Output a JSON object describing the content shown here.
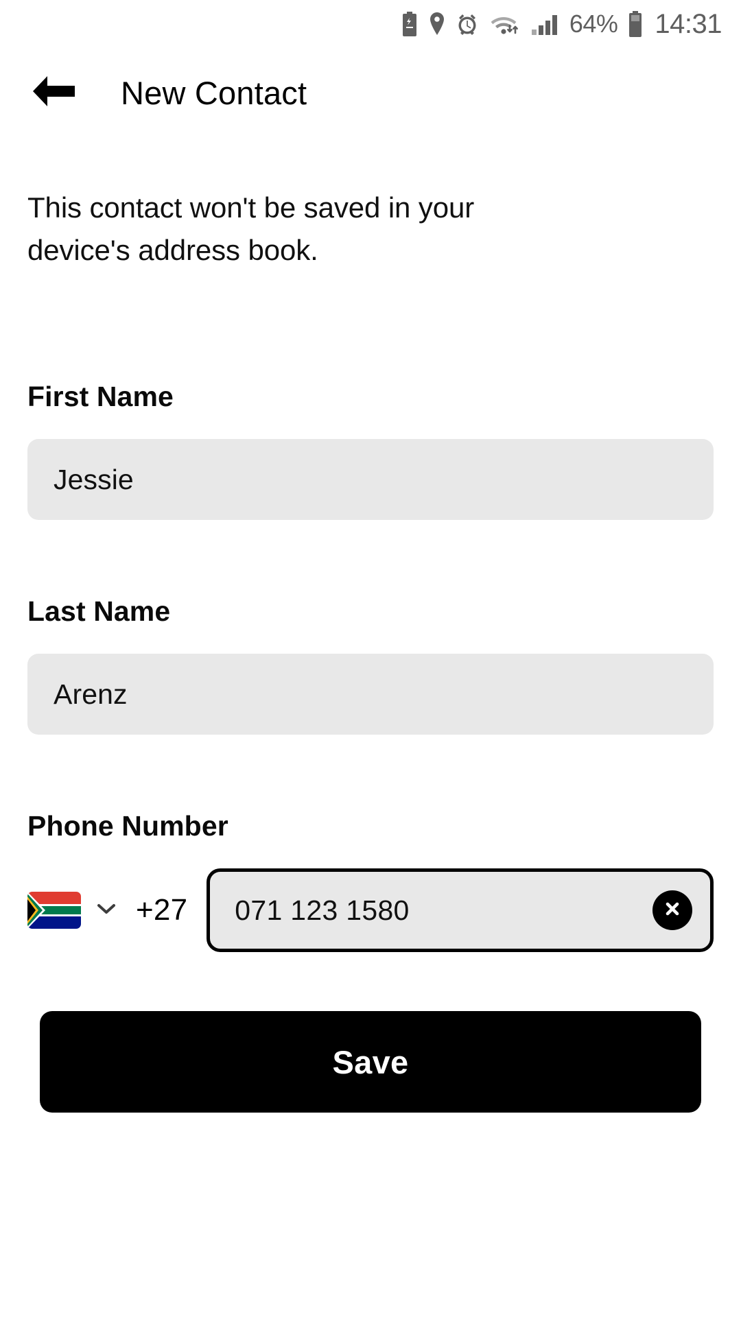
{
  "status_bar": {
    "icons": [
      "battery-saver-icon",
      "location-pin-icon",
      "alarm-icon",
      "wifi-icon",
      "signal-bars-icon"
    ],
    "battery_percent": "64%",
    "time": "14:31",
    "color": "#5f5f5f"
  },
  "app_bar": {
    "back_icon": "arrow-left-icon",
    "title": "New Contact"
  },
  "notice": {
    "text": "This contact won't be saved in your device's address book."
  },
  "fields": {
    "first_name": {
      "label": "First Name",
      "value": "Jessie",
      "placeholder": "First Name"
    },
    "last_name": {
      "label": "Last Name",
      "value": "Arenz",
      "placeholder": "Last Name"
    },
    "phone": {
      "label": "Phone Number",
      "flag": "south-africa-flag-icon",
      "chevron_icon": "chevron-down-icon",
      "dial_code": "+27",
      "value": "071 123 1580",
      "placeholder": "Phone Number",
      "clear_icon": "clear-circle-icon",
      "focused": true
    }
  },
  "save": {
    "label": "Save"
  },
  "colors": {
    "background": "#ffffff",
    "input_fill": "#e8e8e8",
    "text": "#101010",
    "accent": "#000000",
    "status_grey": "#5f5f5f",
    "flag_red": "#e03c31",
    "flag_green": "#007a4d",
    "flag_blue": "#001489",
    "flag_gold": "#ffb81c",
    "flag_black": "#000000",
    "flag_white": "#ffffff"
  }
}
